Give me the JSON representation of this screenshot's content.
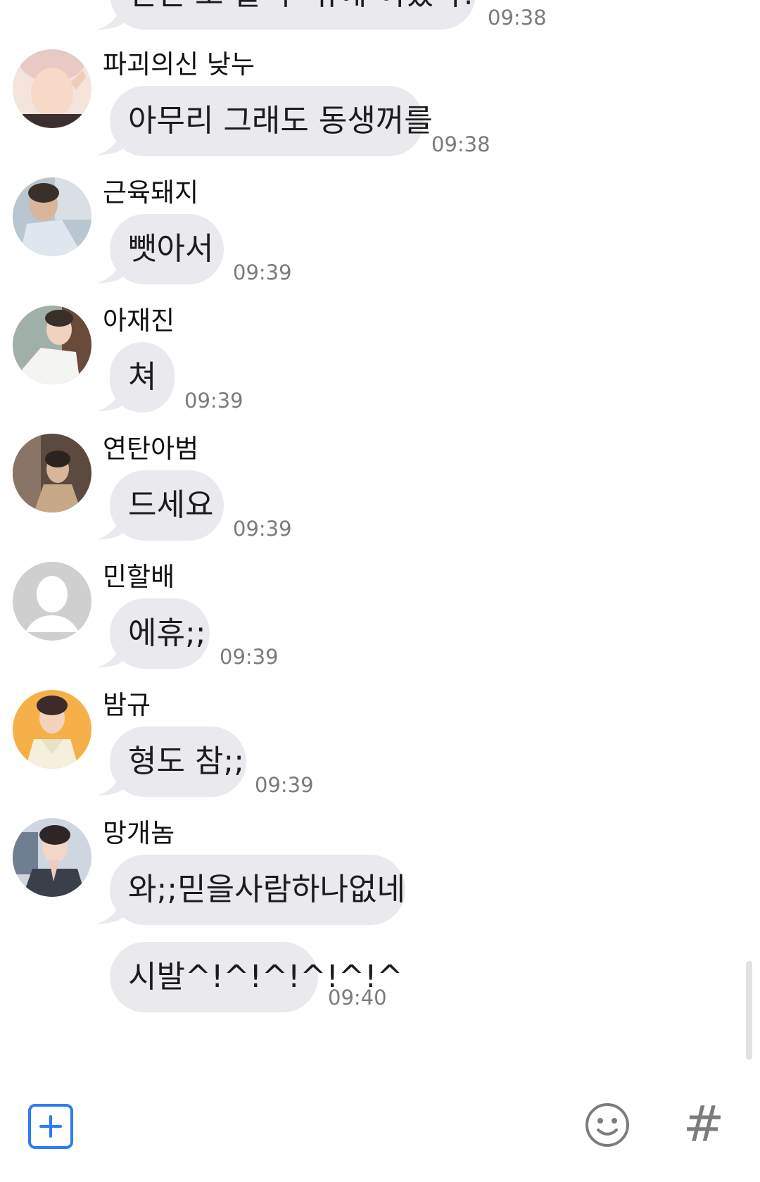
{
  "partial_message": {
    "text": "던진 오 할 수 밖에 이었다!",
    "time": "09:38"
  },
  "messages": [
    {
      "sender": "파괴의신 낮누",
      "text": "아무리 그래도 동생꺼를",
      "time": "09:38"
    },
    {
      "sender": "근육돼지",
      "text": "뺏아서",
      "time": "09:39"
    },
    {
      "sender": "아재진",
      "text": "쳐",
      "time": "09:39"
    },
    {
      "sender": "연탄아범",
      "text": "드세요",
      "time": "09:39"
    },
    {
      "sender": "민할배",
      "text": "에휴;;",
      "time": "09:39"
    },
    {
      "sender": "밤규",
      "text": "형도 참;;",
      "time": "09:39"
    },
    {
      "sender": "망개놈",
      "text": "와;;믿을사람하나없네",
      "time": ""
    },
    {
      "sender": "",
      "text": "시발^!^!^!^!^!^",
      "time": "09:40"
    }
  ],
  "input_bar": {
    "plus_icon": "plus-square-icon",
    "emoji_icon": "smiley-icon",
    "hash_label": "#",
    "accent_color": "#2d7cf5",
    "icon_color": "#7c7c7c"
  },
  "colors": {
    "bubble": "#e9e9ee",
    "time_text": "#7b7b7b",
    "background": "#ffffff"
  }
}
